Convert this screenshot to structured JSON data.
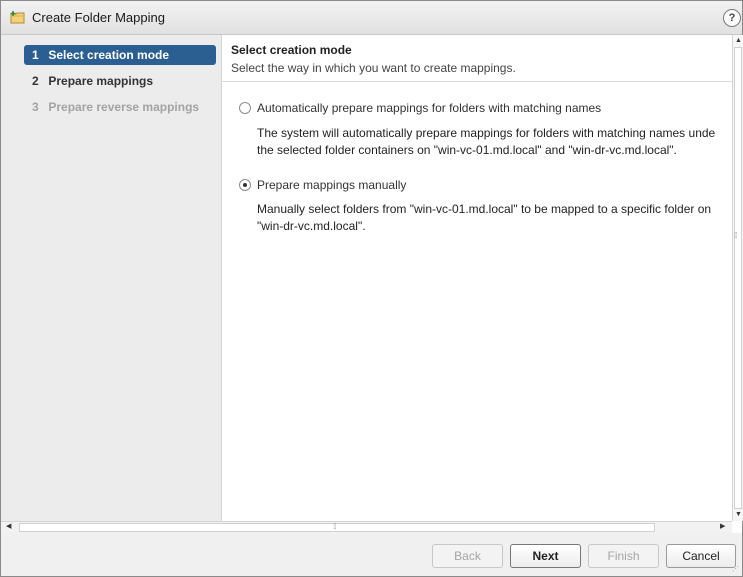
{
  "window": {
    "title": "Create Folder Mapping",
    "help_label": "?"
  },
  "nav": {
    "items": [
      {
        "num": "1",
        "label": "Select creation mode",
        "state": "active"
      },
      {
        "num": "2",
        "label": "Prepare mappings",
        "state": "normal"
      },
      {
        "num": "3",
        "label": "Prepare reverse mappings",
        "state": "disabled"
      }
    ]
  },
  "content": {
    "title": "Select creation mode",
    "subtitle": "Select the way in which you want to create mappings.",
    "options": [
      {
        "label": "Automatically prepare mappings for folders with matching names",
        "selected": false,
        "desc_line1": "The system will automatically prepare mappings for folders with matching names unde",
        "desc_line2": "the selected folder containers on \"win-vc-01.md.local\" and \"win-dr-vc.md.local\"."
      },
      {
        "label": "Prepare mappings manually",
        "selected": true,
        "desc_line1": "Manually select folders from \"win-vc-01.md.local\" to be mapped to a specific folder on",
        "desc_line2": "\"win-dr-vc.md.local\"."
      }
    ]
  },
  "footer": {
    "back_label": "Back",
    "next_label": "Next",
    "finish_label": "Finish",
    "cancel_label": "Cancel"
  },
  "icons": {
    "title_icon": "folder-add-icon",
    "accent_color": "#2b5f91"
  }
}
